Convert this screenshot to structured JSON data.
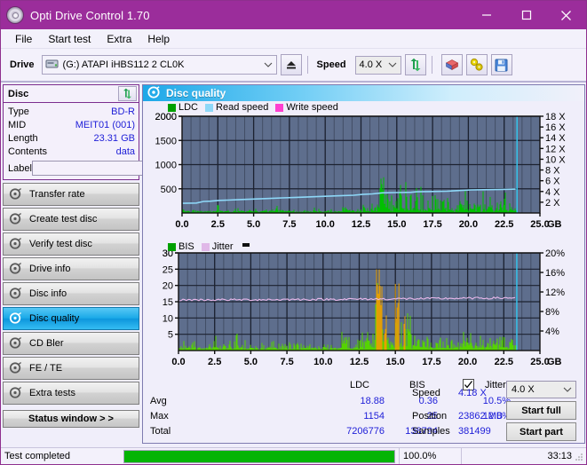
{
  "window": {
    "title": "Opti Drive Control 1.70",
    "icon": "disc-icon",
    "minimize": "minimize-icon",
    "maximize": "maximize-icon",
    "close": "close-icon"
  },
  "menu": {
    "items": [
      "File",
      "Start test",
      "Extra",
      "Help"
    ]
  },
  "toolbar": {
    "drive_label": "Drive",
    "drive_value": "(G:)  ATAPI iHBS112  2 CL0K",
    "eject_icon": "eject-icon",
    "speed_label": "Speed",
    "speed_value": "4.0 X",
    "refresh_icon": "refresh-icon",
    "erase_icon": "eraser-icon",
    "tools_icon": "tools-icon",
    "save_icon": "save-icon"
  },
  "disc": {
    "title": "Disc",
    "refresh_icon": "refresh-icon",
    "rows": [
      {
        "key": "Type",
        "value": "BD-R"
      },
      {
        "key": "MID",
        "value": "MEIT01 (001)"
      },
      {
        "key": "Length",
        "value": "23.31 GB"
      },
      {
        "key": "Contents",
        "value": "data"
      }
    ],
    "label_key": "Label",
    "label_value": "",
    "label_placeholder": "",
    "label_button_icon": "disc-icon"
  },
  "nav": {
    "items": [
      {
        "label": "Transfer rate",
        "icon": "disc-speed-icon",
        "active": false
      },
      {
        "label": "Create test disc",
        "icon": "disc-write-icon",
        "active": false
      },
      {
        "label": "Verify test disc",
        "icon": "disc-verify-icon",
        "active": false
      },
      {
        "label": "Drive info",
        "icon": "drive-info-icon",
        "active": false
      },
      {
        "label": "Disc info",
        "icon": "disc-info-icon",
        "active": false
      },
      {
        "label": "Disc quality",
        "icon": "disc-quality-icon",
        "active": true
      },
      {
        "label": "CD Bler",
        "icon": "disc-bler-icon",
        "active": false
      },
      {
        "label": "FE / TE",
        "icon": "disc-fete-icon",
        "active": false
      },
      {
        "label": "Extra tests",
        "icon": "disc-extra-icon",
        "active": false
      }
    ],
    "status_window": "Status window > >"
  },
  "panel": {
    "title": "Disc quality",
    "icon": "disc-quality-icon"
  },
  "chart_data": [
    {
      "id": "ldc-chart",
      "type": "bar",
      "title": "Disc quality",
      "xlabel": "GB",
      "ylabel": "",
      "xlim": [
        0,
        25
      ],
      "ylim": [
        0,
        2000
      ],
      "y2lim": [
        0,
        18
      ],
      "grid": true,
      "legend": [
        {
          "name": "LDC",
          "color": "#00b000"
        },
        {
          "name": "Read speed",
          "color": "#8ed8f8"
        },
        {
          "name": "Write speed",
          "color": "#ff40d0"
        }
      ],
      "xticks": [
        "0.0",
        "2.5",
        "5.0",
        "7.5",
        "10.0",
        "12.5",
        "15.0",
        "17.5",
        "20.0",
        "22.5",
        "25.0"
      ],
      "yticks": [
        "500",
        "1000",
        "1500",
        "2000"
      ],
      "y2ticks": [
        "2 X",
        "4 X",
        "6 X",
        "8 X",
        "10 X",
        "12 X",
        "14 X",
        "16 X",
        "18 X"
      ],
      "x_unit_label": "GB",
      "series": [
        {
          "name": "LDC",
          "color": "#00c000",
          "x": [
            0.05,
            0.2,
            0.4,
            0.6,
            0.8,
            1.0,
            1.2,
            1.4,
            1.6,
            1.8,
            2.0,
            2.2,
            2.4,
            2.55,
            2.6,
            2.7,
            2.85,
            3.0,
            3.2,
            3.4,
            3.6,
            3.8,
            4.0,
            4.2,
            4.4,
            4.6,
            4.8,
            5.0,
            5.2,
            5.4,
            5.6,
            5.8,
            6.0,
            6.2,
            6.4,
            6.6,
            6.8,
            7.0,
            7.2,
            7.4,
            7.6,
            7.8,
            8.0,
            8.2,
            8.4,
            8.6,
            8.8,
            9.0,
            9.2,
            9.4,
            9.6,
            9.8,
            10.0,
            10.2,
            10.4,
            10.6,
            10.8,
            11.0,
            11.2,
            11.4,
            11.6,
            11.75,
            11.9,
            12.1,
            12.3,
            12.5,
            12.65,
            12.8,
            13.0,
            13.2,
            13.4,
            13.6,
            13.75,
            13.85,
            13.95,
            14.05,
            14.15,
            14.25,
            14.35,
            14.45,
            14.55,
            14.65,
            14.75,
            14.85,
            14.95,
            15.05,
            15.15,
            15.25,
            15.35,
            15.45,
            15.55,
            15.65,
            15.75,
            15.85,
            15.95,
            16.05,
            16.2,
            16.35,
            16.5,
            16.65,
            16.8,
            17.0,
            17.2,
            17.4,
            17.6,
            17.8,
            18.0,
            18.2,
            18.4,
            18.6,
            18.8,
            19.0,
            19.2,
            19.4,
            19.6,
            19.8,
            20.0,
            20.2,
            20.4,
            20.6,
            20.8,
            21.0,
            21.2,
            21.4,
            21.6,
            21.8,
            22.0,
            22.2,
            22.4,
            22.6,
            22.8,
            23.0,
            23.2,
            23.35
          ],
          "y": [
            120,
            60,
            80,
            50,
            70,
            60,
            90,
            55,
            65,
            50,
            70,
            60,
            80,
            330,
            200,
            140,
            95,
            70,
            90,
            60,
            120,
            70,
            200,
            80,
            60,
            100,
            55,
            70,
            90,
            50,
            60,
            120,
            55,
            70,
            60,
            170,
            80,
            55,
            70,
            100,
            60,
            80,
            55,
            70,
            60,
            90,
            55,
            65,
            120,
            60,
            80,
            50,
            70,
            60,
            100,
            55,
            70,
            60,
            90,
            250,
            320,
            200,
            110,
            90,
            160,
            280,
            330,
            210,
            160,
            300,
            520,
            420,
            600,
            1150,
            900,
            780,
            980,
            620,
            740,
            520,
            680,
            430,
            560,
            640,
            420,
            1100,
            820,
            940,
            600,
            780,
            430,
            900,
            560,
            680,
            420,
            700,
            520,
            760,
            430,
            580,
            360,
            420,
            300,
            360,
            280,
            420,
            320,
            500,
            280,
            360,
            260,
            400,
            300,
            540,
            320,
            440,
            280,
            500,
            340,
            420,
            280,
            560,
            300,
            620,
            340,
            480,
            300,
            420,
            260,
            380,
            240,
            340,
            180,
            260,
            140
          ]
        },
        {
          "name": "Read speed",
          "color": "#8ed8f8",
          "type": "line",
          "x": [
            0.05,
            1.0,
            1.5,
            2.0,
            2.6,
            3.2,
            4.0,
            5.0,
            6.0,
            7.0,
            8.0,
            9.0,
            10.0,
            11.0,
            12.0,
            12.6,
            13.3,
            14.0,
            15.0,
            16.0,
            16.4,
            17.5,
            18.5,
            19.5,
            20.2,
            21.5,
            22.5,
            23.3
          ],
          "y_speed": [
            1.8,
            1.85,
            2.15,
            2.2,
            2.35,
            2.4,
            2.5,
            2.6,
            2.7,
            2.8,
            2.9,
            3.0,
            3.1,
            3.2,
            3.3,
            3.45,
            3.55,
            3.75,
            3.8,
            3.85,
            3.95,
            4.0,
            4.05,
            4.2,
            4.3,
            4.35,
            4.4,
            4.45
          ]
        }
      ],
      "cursor_x": 23.4,
      "cursor_color": "#32c8f0"
    },
    {
      "id": "bis-jitter-chart",
      "type": "bar",
      "title": "",
      "xlabel": "GB",
      "xlim": [
        0,
        25
      ],
      "ylim": [
        0,
        30
      ],
      "y2lim": [
        0,
        20
      ],
      "grid": true,
      "legend": [
        {
          "name": "BIS",
          "color": "#00b000"
        },
        {
          "name": "Jitter",
          "color": "#e0b8e8"
        }
      ],
      "xticks": [
        "0.0",
        "2.5",
        "5.0",
        "7.5",
        "10.0",
        "12.5",
        "15.0",
        "17.5",
        "20.0",
        "22.5",
        "25.0"
      ],
      "yticks": [
        "5",
        "10",
        "15",
        "20",
        "25",
        "30"
      ],
      "y2ticks": [
        "4%",
        "8%",
        "12%",
        "16%",
        "20%"
      ],
      "x_unit_label": "GB",
      "series": [
        {
          "name": "BIS",
          "color": "#55d400",
          "x": [
            0.05,
            0.2,
            0.4,
            0.6,
            0.8,
            1.0,
            1.2,
            1.4,
            1.6,
            1.8,
            2.0,
            2.2,
            2.4,
            2.55,
            2.6,
            2.7,
            2.85,
            3.0,
            3.2,
            3.4,
            3.6,
            3.8,
            4.0,
            4.2,
            4.4,
            4.6,
            4.8,
            5.0,
            5.2,
            5.4,
            5.6,
            5.8,
            6.0,
            6.2,
            6.4,
            6.6,
            6.8,
            7.0,
            7.2,
            7.4,
            7.6,
            7.8,
            8.0,
            8.2,
            8.4,
            8.6,
            8.8,
            9.0,
            9.2,
            9.4,
            9.6,
            9.8,
            10.0,
            10.2,
            10.4,
            10.6,
            10.8,
            11.0,
            11.2,
            11.4,
            11.6,
            11.75,
            11.9,
            12.1,
            12.3,
            12.5,
            12.65,
            12.8,
            13.0,
            13.2,
            13.4,
            13.6,
            13.75,
            13.85,
            13.95,
            14.05,
            14.15,
            14.25,
            14.35,
            14.45,
            14.55,
            14.65,
            14.75,
            14.85,
            14.95,
            15.05,
            15.15,
            15.25,
            15.35,
            15.45,
            15.55,
            15.65,
            15.75,
            15.85,
            15.95,
            16.05,
            16.2,
            16.35,
            16.5,
            16.65,
            16.8,
            17.0,
            17.2,
            17.4,
            17.6,
            17.8,
            18.0,
            18.2,
            18.4,
            18.6,
            18.8,
            19.0,
            19.2,
            19.4,
            19.6,
            19.8,
            20.0,
            20.2,
            20.4,
            20.6,
            20.8,
            21.0,
            21.2,
            21.4,
            21.6,
            21.8,
            22.0,
            22.2,
            22.4,
            22.6,
            22.8,
            23.0,
            23.2,
            23.35
          ],
          "y": [
            4.5,
            2.0,
            3.0,
            1.8,
            2.5,
            2.2,
            3.0,
            1.9,
            2.2,
            1.8,
            2.4,
            2.1,
            2.8,
            9.8,
            6.5,
            4.5,
            3.2,
            2.4,
            3.0,
            2.0,
            4.0,
            2.4,
            6.2,
            2.7,
            2.1,
            3.4,
            1.9,
            2.4,
            3.0,
            1.7,
            2.0,
            4.0,
            1.9,
            2.4,
            2.0,
            5.8,
            2.7,
            1.9,
            2.4,
            3.4,
            2.0,
            2.7,
            1.9,
            2.4,
            2.0,
            3.0,
            1.9,
            2.2,
            4.0,
            2.0,
            2.7,
            1.7,
            2.4,
            2.0,
            3.4,
            1.9,
            2.4,
            2.0,
            3.0,
            8.5,
            7.2,
            4.5,
            3.2,
            2.6,
            4.6,
            6.0,
            7.4,
            5.2,
            4.0,
            7.0,
            11.0,
            9.0,
            25.0,
            16.0,
            13.5,
            10.0,
            15.0,
            8.5,
            11.0,
            7.4,
            10.0,
            6.2,
            8.0,
            9.5,
            6.0,
            22.0,
            12.0,
            14.0,
            8.6,
            11.0,
            6.4,
            13.5,
            8.0,
            10.0,
            6.0,
            10.2,
            7.5,
            11.0,
            6.4,
            8.5,
            5.2,
            6.2,
            4.4,
            5.4,
            4.0,
            6.2,
            4.8,
            7.4,
            4.2,
            5.4,
            3.8,
            6.0,
            4.4,
            8.0,
            4.6,
            6.6,
            4.0,
            13.0,
            5.0,
            6.2,
            4.2,
            8.4,
            4.4,
            9.2,
            5.0,
            13.0,
            4.6,
            6.2,
            3.8,
            5.6,
            3.6,
            5.0,
            2.6,
            3.8,
            2.2
          ]
        },
        {
          "name": "Jitter",
          "color": "#e8b8ea",
          "type": "line",
          "avg_percent": 10.5
        }
      ],
      "cursor_x": 23.4,
      "cursor_color": "#32c8f0"
    }
  ],
  "stats": {
    "col_headers": [
      "LDC",
      "BIS"
    ],
    "row_headers": [
      "Avg",
      "Max",
      "Total"
    ],
    "ldc": {
      "avg": "18.88",
      "max": "1154",
      "total": "7206776"
    },
    "bis": {
      "avg": "0.36",
      "max": "25",
      "total": "138794"
    },
    "jitter": {
      "label": "Jitter",
      "checked": true,
      "avg": "10.5%",
      "max": "12.0%"
    },
    "speed_label": "Speed",
    "speed_value": "4.18 X",
    "position_label": "Position",
    "position_value": "23862 MB",
    "samples_label": "Samples",
    "samples_value": "381499",
    "speed_select": "4.0 X",
    "start_full": "Start full",
    "start_part": "Start part"
  },
  "statusbar": {
    "text": "Test completed",
    "progress_percent": 100,
    "percent_label": "100.0%",
    "time": "33:13"
  },
  "colors": {
    "accent": "#9b2d9b",
    "chart_bg": "#5e6e8d",
    "chart_grid": "#2b3344",
    "ldc_green": "#00c000",
    "bis_green": "#55d400",
    "read_speed": "#8ed8f8",
    "write_speed": "#ff40d0",
    "jitter": "#e8b8ea",
    "cursor": "#32c8f0",
    "value_blue": "#2020d8",
    "progress_green": "#04b404"
  }
}
